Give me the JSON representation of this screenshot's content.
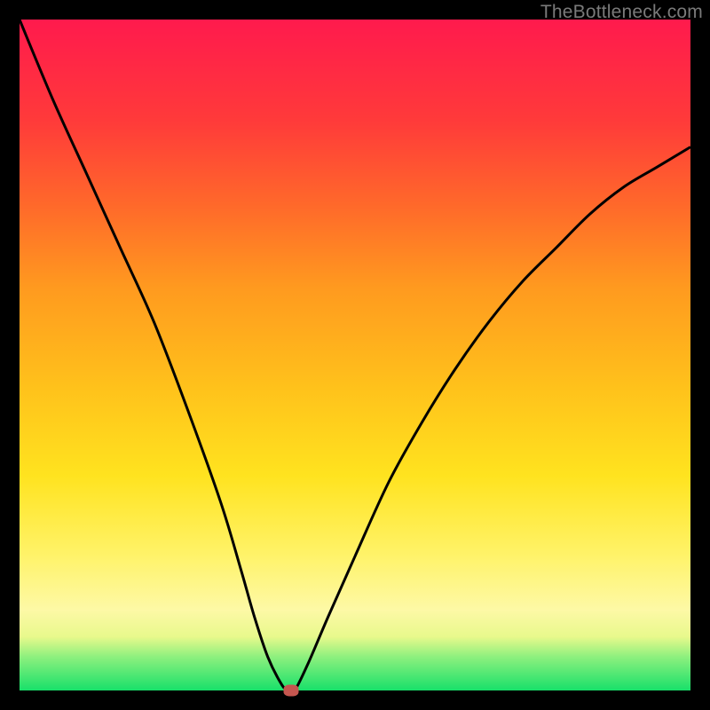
{
  "watermark": "TheBottleneck.com",
  "chart_data": {
    "type": "line",
    "title": "",
    "xlabel": "",
    "ylabel": "",
    "xlim": [
      0,
      100
    ],
    "ylim": [
      0,
      100
    ],
    "series": [
      {
        "name": "bottleneck-curve",
        "x": [
          0,
          5,
          10,
          15,
          20,
          25,
          30,
          33,
          35,
          37,
          39,
          40,
          41,
          43,
          46,
          50,
          55,
          60,
          65,
          70,
          75,
          80,
          85,
          90,
          95,
          100
        ],
        "y": [
          100,
          88,
          77,
          66,
          55,
          42,
          28,
          18,
          11,
          5,
          1,
          0,
          0,
          4,
          11,
          20,
          31,
          40,
          48,
          55,
          61,
          66,
          71,
          75,
          78,
          81
        ]
      }
    ],
    "marker": {
      "x": 40.5,
      "y": 0
    },
    "gradient_stops": [
      {
        "offset": 0.0,
        "color": "#ff1a4d"
      },
      {
        "offset": 0.15,
        "color": "#ff3a3a"
      },
      {
        "offset": 0.28,
        "color": "#ff6a2a"
      },
      {
        "offset": 0.4,
        "color": "#ff9a1f"
      },
      {
        "offset": 0.55,
        "color": "#ffc21b"
      },
      {
        "offset": 0.68,
        "color": "#ffe31f"
      },
      {
        "offset": 0.8,
        "color": "#fff36a"
      },
      {
        "offset": 0.88,
        "color": "#fdf9a6"
      },
      {
        "offset": 0.92,
        "color": "#e8f98c"
      },
      {
        "offset": 0.95,
        "color": "#8df07e"
      },
      {
        "offset": 1.0,
        "color": "#18e06a"
      }
    ]
  },
  "layout": {
    "plot_left": 22,
    "plot_top": 22,
    "plot_size": 756
  }
}
